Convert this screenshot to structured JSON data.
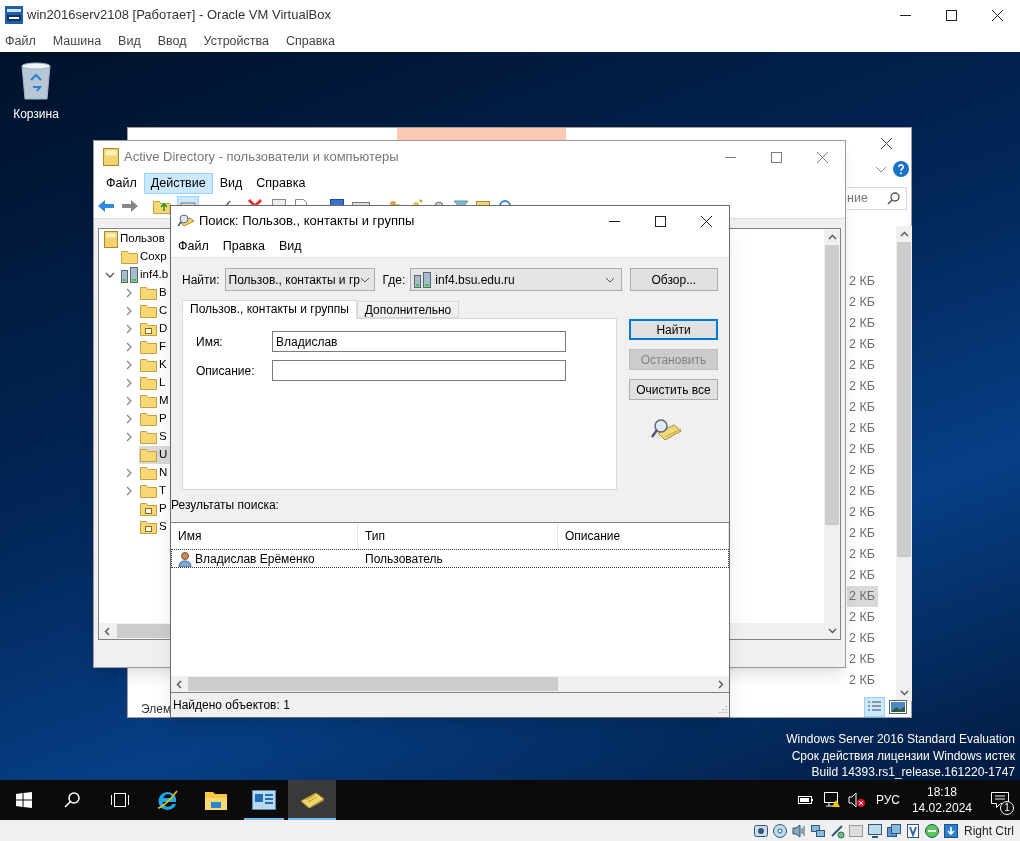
{
  "vbox": {
    "title": "win2016serv2108 [Работает] - Oracle VM VirtualBox",
    "menu": [
      "Файл",
      "Машина",
      "Вид",
      "Ввод",
      "Устройства",
      "Справка"
    ],
    "host_key": "Right Ctrl"
  },
  "desktop": {
    "icons": [
      {
        "label": "Корзина"
      }
    ],
    "edition_notice": [
      "Windows Server 2016 Standard Evaluation",
      "Срок действия лицензии Windows истек",
      "Build 14393.rs1_release.161220-1747"
    ]
  },
  "explorer": {
    "search_text": "ние",
    "sizes": [
      {
        "text": "2 КБ",
        "selected": false
      },
      {
        "text": "2 КБ",
        "selected": false
      },
      {
        "text": "2 КБ",
        "selected": false
      },
      {
        "text": "2 КБ",
        "selected": false
      },
      {
        "text": "2 КБ",
        "selected": false
      },
      {
        "text": "2 КБ",
        "selected": false
      },
      {
        "text": "2 КБ",
        "selected": false
      },
      {
        "text": "2 КБ",
        "selected": false
      },
      {
        "text": "2 КБ",
        "selected": false
      },
      {
        "text": "2 КБ",
        "selected": false
      },
      {
        "text": "2 КБ",
        "selected": false
      },
      {
        "text": "2 КБ",
        "selected": false
      },
      {
        "text": "2 КБ",
        "selected": false
      },
      {
        "text": "2 КБ",
        "selected": false
      },
      {
        "text": "2 КБ",
        "selected": false
      },
      {
        "text": "2 КБ",
        "selected": true
      },
      {
        "text": "2 КБ",
        "selected": false
      },
      {
        "text": "2 КБ",
        "selected": false
      },
      {
        "text": "2 КБ",
        "selected": false
      },
      {
        "text": "2 КБ",
        "selected": false
      }
    ],
    "status": "Элем"
  },
  "ad_window": {
    "title": "Active Directory - пользователи и компьютеры",
    "menu": [
      {
        "label": "Файл",
        "selected": false
      },
      {
        "label": "Действие",
        "selected": true
      },
      {
        "label": "Вид",
        "selected": false
      },
      {
        "label": "Справка",
        "selected": false
      }
    ],
    "tree": [
      {
        "label": "Пользов",
        "kind": "root",
        "selected": false,
        "children": [
          {
            "label": "Сохр",
            "kind": "folder",
            "selected": false
          },
          {
            "label": "inf4.b",
            "kind": "domain",
            "expanded": true,
            "selected": false,
            "children": [
              {
                "label": "B",
                "kind": "folder",
                "expanded": false,
                "selected": false
              },
              {
                "label": "C",
                "kind": "folder",
                "expanded": false,
                "selected": false
              },
              {
                "label": "D",
                "kind": "ou",
                "expanded": false,
                "selected": false
              },
              {
                "label": "F",
                "kind": "folder",
                "expanded": false,
                "selected": false
              },
              {
                "label": "K",
                "kind": "folder",
                "expanded": false,
                "selected": false
              },
              {
                "label": "L",
                "kind": "folder",
                "expanded": false,
                "selected": false
              },
              {
                "label": "M",
                "kind": "folder",
                "expanded": false,
                "selected": false
              },
              {
                "label": "P",
                "kind": "folder",
                "expanded": false,
                "selected": false
              },
              {
                "label": "S",
                "kind": "folder",
                "expanded": false,
                "selected": false
              },
              {
                "label": "U",
                "kind": "folder",
                "selected": true
              },
              {
                "label": "N",
                "kind": "folder",
                "expanded": false,
                "selected": false
              },
              {
                "label": "T",
                "kind": "folder",
                "expanded": false,
                "selected": false
              },
              {
                "label": "P",
                "kind": "ou",
                "selected": false
              },
              {
                "label": "S",
                "kind": "ou",
                "selected": false
              }
            ]
          }
        ]
      }
    ]
  },
  "search_dialog": {
    "title": "Поиск: Пользов., контакты и группы",
    "menu": [
      "Файл",
      "Правка",
      "Вид"
    ],
    "find_label": "Найти:",
    "find_value": "Пользов., контакты и гр",
    "where_label": "Где:",
    "where_value": "inf4.bsu.edu.ru",
    "browse_button": "Обзор...",
    "tabs": [
      {
        "label": "Пользов., контакты и группы",
        "selected": true
      },
      {
        "label": "Дополнительно",
        "selected": false
      }
    ],
    "fields": [
      {
        "label": "Имя:",
        "value": "Владислав"
      },
      {
        "label": "Описание:"
      }
    ],
    "buttons": [
      {
        "label": "Найти",
        "default": true,
        "disabled": false
      },
      {
        "label": "Остановить",
        "default": false,
        "disabled": true
      },
      {
        "label": "Очистить все",
        "default": false,
        "disabled": false
      }
    ],
    "results_label": "Результаты поиска:",
    "results": {
      "columns": [
        "Имя",
        "Тип",
        "Описание"
      ],
      "rows": [
        {
          "name": "Владислав Ерёменко",
          "type": "Пользователь",
          "selected": true
        }
      ]
    },
    "status": "Найдено объектов: 1"
  },
  "taskbar": {
    "apps": [
      {
        "kind": "browser",
        "running": false,
        "active": false
      },
      {
        "kind": "files",
        "running": false,
        "active": false
      },
      {
        "kind": "console",
        "running": true,
        "active": false
      },
      {
        "kind": "search",
        "running": true,
        "active": true
      }
    ],
    "language": "РУС",
    "time": "18:18",
    "date": "14.02.2024",
    "notifications": "1"
  }
}
